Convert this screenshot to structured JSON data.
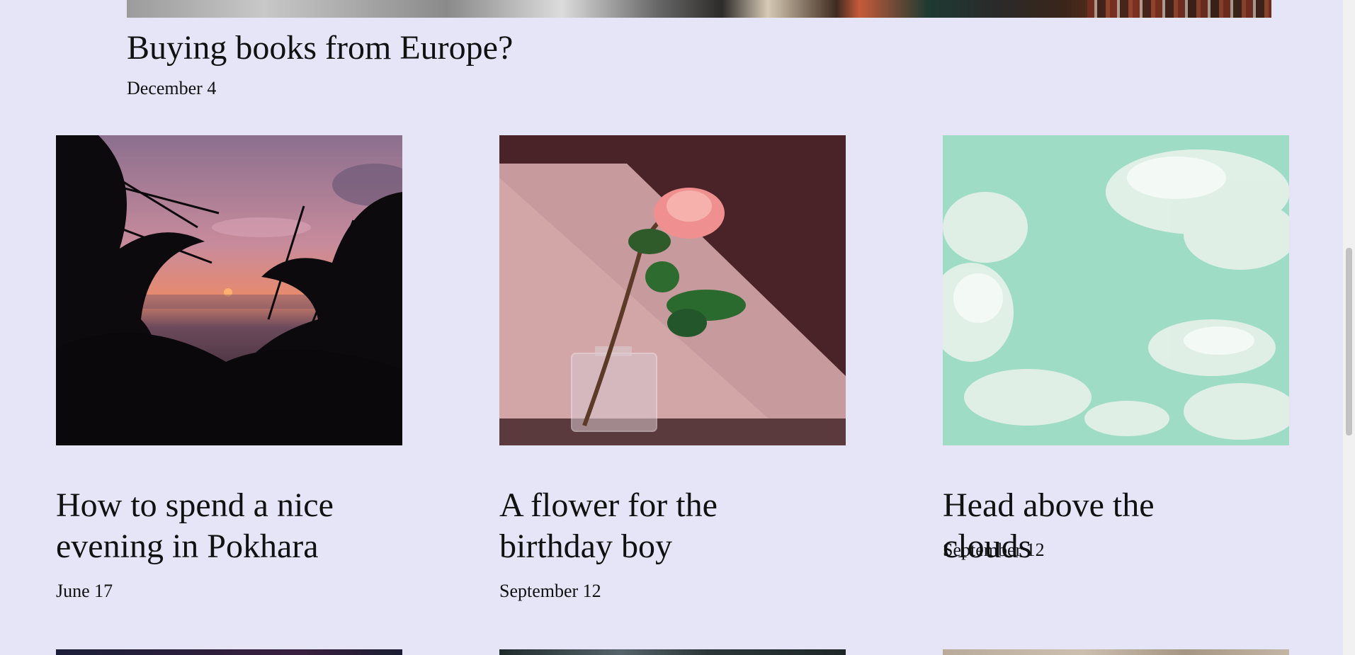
{
  "featured": {
    "title": "Buying books from Europe?",
    "date": "December 4"
  },
  "posts": [
    {
      "title": "How to spend a nice evening in Pokhara",
      "date": "June 17",
      "image": "palm-sunset"
    },
    {
      "title": "A flower for the birthday boy",
      "date": "September 12",
      "image": "rose-in-vase"
    },
    {
      "title": "Head above the clouds",
      "date": "September 12",
      "image": "clouds-sky"
    }
  ],
  "colors": {
    "background": "#e6e5f8",
    "text": "#111111"
  }
}
